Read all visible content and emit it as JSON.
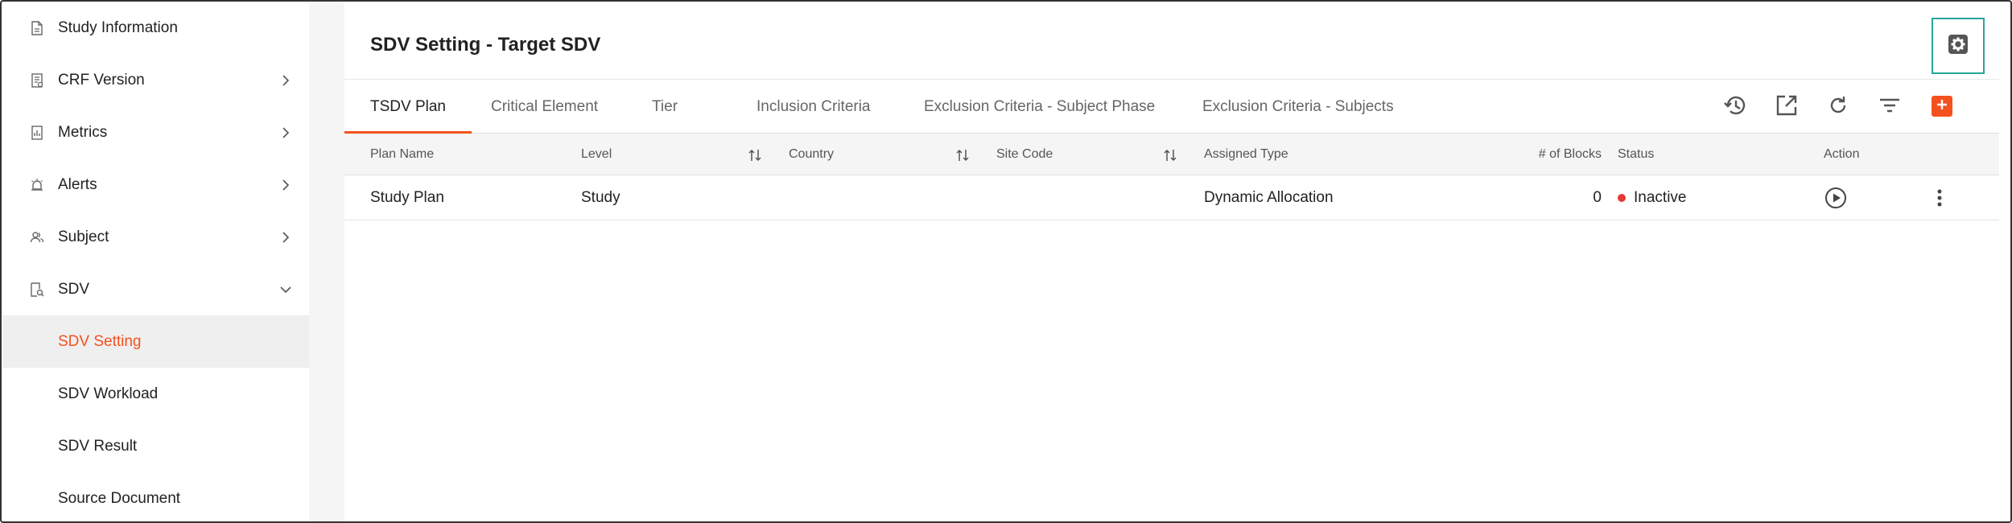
{
  "sidebar": {
    "items": [
      {
        "label": "Study Information"
      },
      {
        "label": "CRF Version"
      },
      {
        "label": "Metrics"
      },
      {
        "label": "Alerts"
      },
      {
        "label": "Subject"
      },
      {
        "label": "SDV"
      },
      {
        "label": "SDV Setting"
      },
      {
        "label": "SDV Workload"
      },
      {
        "label": "SDV Result"
      },
      {
        "label": "Source Document"
      }
    ]
  },
  "header": {
    "title": "SDV Setting - Target SDV"
  },
  "tabs": [
    {
      "label": "TSDV Plan"
    },
    {
      "label": "Critical Element"
    },
    {
      "label": "Tier"
    },
    {
      "label": "Inclusion Criteria"
    },
    {
      "label": "Exclusion Criteria - Subject Phase"
    },
    {
      "label": "Exclusion Criteria - Subjects"
    }
  ],
  "table": {
    "columns": [
      "Plan Name",
      "Level",
      "Country",
      "Site Code",
      "Assigned Type",
      "# of Blocks",
      "Status",
      "Action"
    ],
    "rows": [
      {
        "plan_name": "Study Plan",
        "level": "Study",
        "country": "",
        "site_code": "",
        "assigned_type": "Dynamic Allocation",
        "blocks": "0",
        "status": "Inactive"
      }
    ]
  },
  "colors": {
    "accent": "#f4511e",
    "highlight_border": "#26a69a",
    "status_inactive": "#e53935"
  },
  "icons": {
    "settings": "gear-square-icon",
    "history": "history-icon",
    "export": "open-external-icon",
    "refresh": "refresh-icon",
    "filter": "filter-icon",
    "add": "plus-icon",
    "play": "play-circle-icon",
    "more": "more-vertical-icon"
  }
}
